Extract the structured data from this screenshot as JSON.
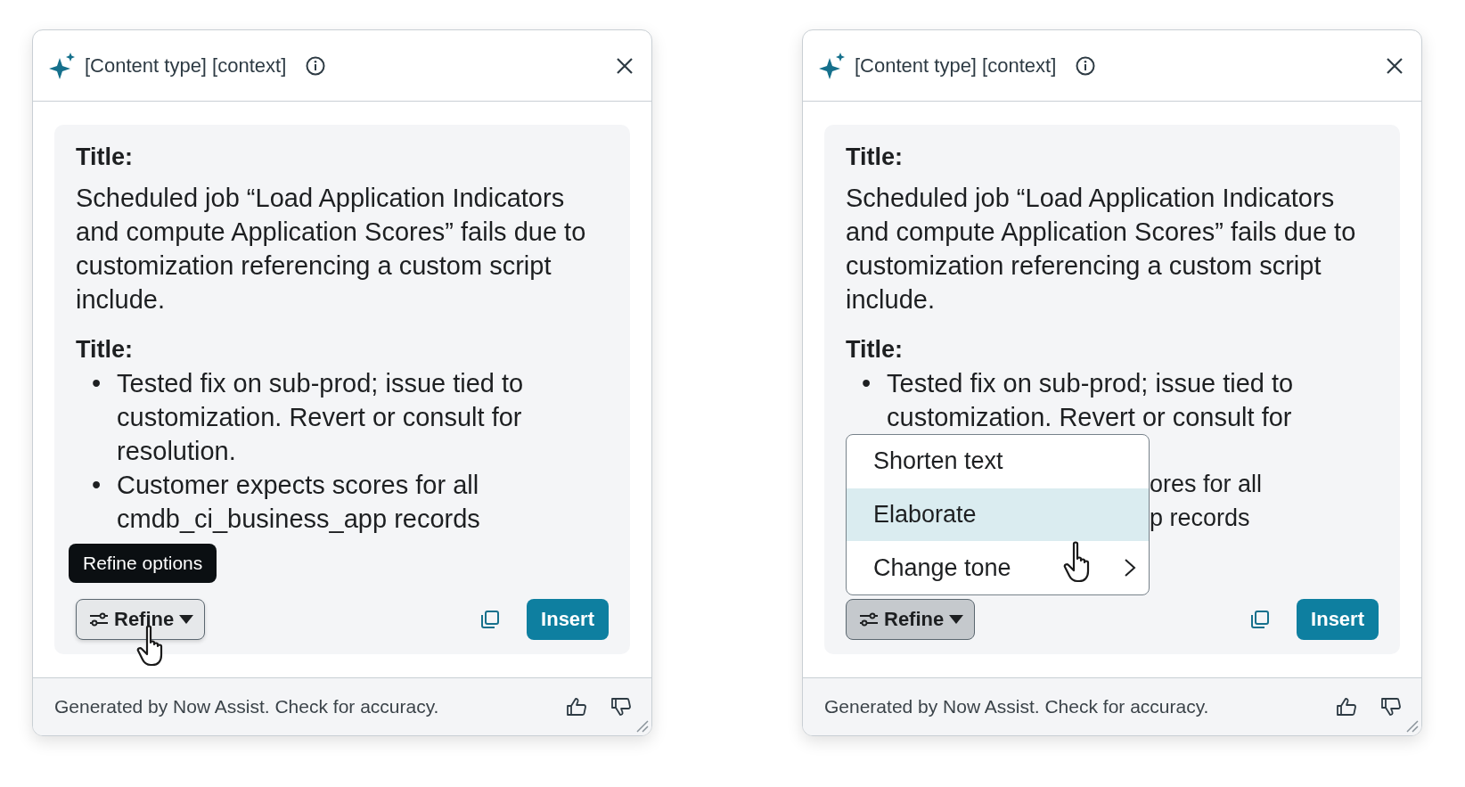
{
  "panels": [
    {
      "title": "[Content type] [context]",
      "sections": [
        {
          "heading": "Title:",
          "kind": "paragraph",
          "text": "Scheduled job “Load Application Indicators and compute Application Scores” fails due to customization referencing a custom script include."
        },
        {
          "heading": "Title:",
          "kind": "bullets",
          "items": [
            {
              "bullet": "•",
              "text": "Tested fix on sub-prod; issue tied to customization. Revert or consult for resolution."
            },
            {
              "bullet": "•",
              "text": "Customer expects scores for all cmdb_ci_business_app records"
            }
          ]
        }
      ],
      "tooltip": "Refine options",
      "refine": {
        "label": "Refine",
        "open": false
      },
      "insert": "Insert",
      "footer": "Generated by Now Assist. Check for accuracy."
    },
    {
      "title": "[Content type] [context]",
      "sections": [
        {
          "heading": "Title:",
          "kind": "paragraph",
          "text": "Scheduled job “Load Application Indicators and compute Application Scores” fails due to customization referencing a custom script include."
        },
        {
          "heading": "Title:",
          "kind": "bullets",
          "items": [
            {
              "bullet": "•",
              "text": "Tested fix on sub-prod; issue tied to customization. Revert or consult for"
            }
          ]
        }
      ],
      "menu": {
        "items": [
          {
            "label": "Shorten text",
            "kind": "action",
            "selected": false
          },
          {
            "label": "Elaborate",
            "kind": "action",
            "selected": true
          },
          {
            "label": "Change tone",
            "kind": "submenu",
            "selected": false
          }
        ],
        "partly_covered_text": [
          "ores for all",
          "p records"
        ]
      },
      "refine": {
        "label": "Refine",
        "open": true
      },
      "insert": "Insert",
      "footer": "Generated by Now Assist. Check for accuracy."
    }
  ]
}
